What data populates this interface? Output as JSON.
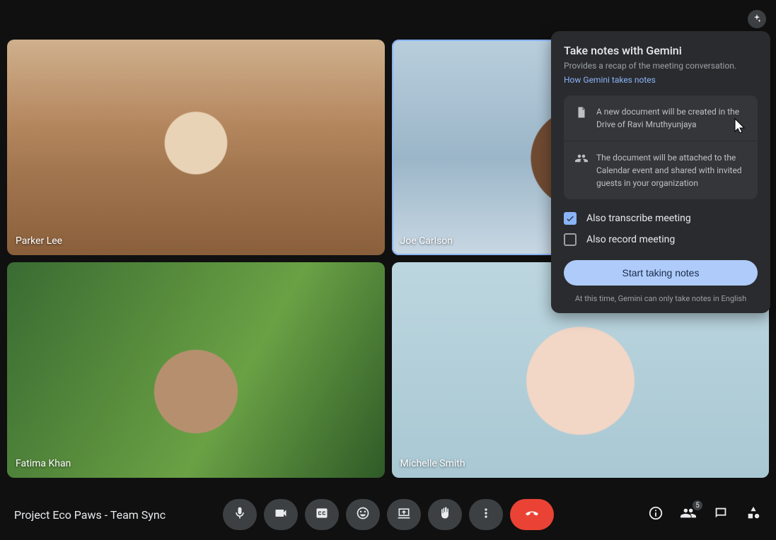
{
  "meeting": {
    "title": "Project Eco Paws - Team Sync",
    "participant_count": 5
  },
  "participants": [
    {
      "name": "Parker Lee",
      "active": false
    },
    {
      "name": "Joe Carlson",
      "active": true
    },
    {
      "name": "Fatima Khan",
      "active": false
    },
    {
      "name": "Michelle Smith",
      "active": false
    }
  ],
  "gemini_panel": {
    "title": "Take notes with Gemini",
    "subtitle": "Provides a recap of the meeting conversation.",
    "link_text": "How Gemini takes notes",
    "info": [
      "A new document will be created in the Drive of Ravi Mruthyunjaya",
      "The document will be attached to the Calendar event and shared with invited guests in your organization"
    ],
    "checkbox_transcribe": {
      "label": "Also transcribe meeting",
      "checked": true
    },
    "checkbox_record": {
      "label": "Also record meeting",
      "checked": false
    },
    "start_button": "Start taking notes",
    "disclaimer": "At this time, Gemini can only take notes in English"
  },
  "controls": {
    "mic": "microphone",
    "camera": "camera",
    "captions": "captions",
    "emoji": "reactions",
    "present": "present",
    "raise_hand": "raise-hand",
    "more": "more-options",
    "end_call": "leave-call"
  },
  "right_bar": {
    "info": "meeting-details",
    "people": "people",
    "chat": "chat",
    "activities": "activities"
  }
}
